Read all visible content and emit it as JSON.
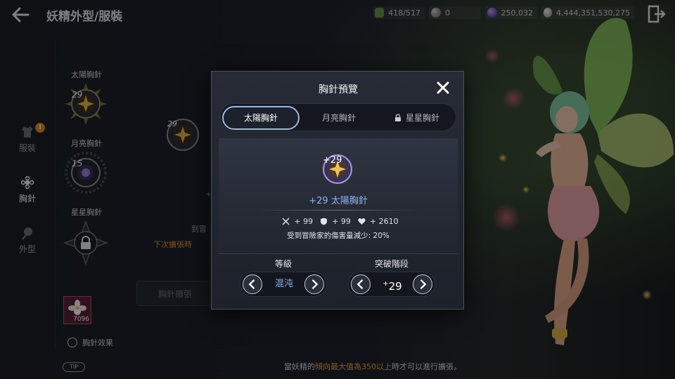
{
  "header": {
    "title": "妖精外型/服裝",
    "currencies": [
      {
        "icon": "fairy-essence-icon",
        "value": "418/517"
      },
      {
        "icon": "gray-orb-icon",
        "value": "0"
      },
      {
        "icon": "purple-orb-icon",
        "value": "250,032"
      },
      {
        "icon": "silver-coin-icon",
        "value": "4,444,351,530,275"
      }
    ]
  },
  "rail": {
    "items": [
      {
        "label": "服裝",
        "icon": "clothes-icon",
        "badge": "!"
      },
      {
        "label": "胸針",
        "icon": "brooch-icon"
      },
      {
        "label": "外型",
        "icon": "appearance-icon"
      }
    ]
  },
  "brooches": {
    "sun": {
      "label": "太陽胸針",
      "level": "29"
    },
    "moon": {
      "label": "月亮胸針",
      "level": "15"
    },
    "star": {
      "label": "星星胸針"
    }
  },
  "background": {
    "selected_level": "29",
    "text_fragment_1": "+",
    "text_fragment_2": "到冒",
    "next_expand": "下次擴張時",
    "expand_button": "胸針擴張"
  },
  "lower_left": {
    "item_count": "7096",
    "effect_link": "胸針效果",
    "tip": "TIP"
  },
  "notice": {
    "prefix": "當妖精的",
    "highlight": "傾向最大值為350以上",
    "suffix": "時才可以進行擴張。"
  },
  "modal": {
    "title": "胸針預覽",
    "tabs": [
      {
        "label": "太陽胸針",
        "active": true
      },
      {
        "label": "月亮胸針",
        "active": false
      },
      {
        "label": "星星胸針",
        "active": false,
        "locked": true
      }
    ],
    "preview": {
      "level": "+29",
      "name": "+29 太陽胸針",
      "stats": [
        {
          "icon": "attack-icon",
          "value": "+ 99"
        },
        {
          "icon": "defense-icon",
          "value": "+ 99"
        },
        {
          "icon": "hp-icon",
          "value": "+ 2610"
        }
      ],
      "description": "受到冒險家的傷害量減少: 20%"
    },
    "grade": {
      "label": "等級",
      "value": "混沌"
    },
    "breakthrough": {
      "label": "突破階段",
      "value": "29"
    }
  }
}
